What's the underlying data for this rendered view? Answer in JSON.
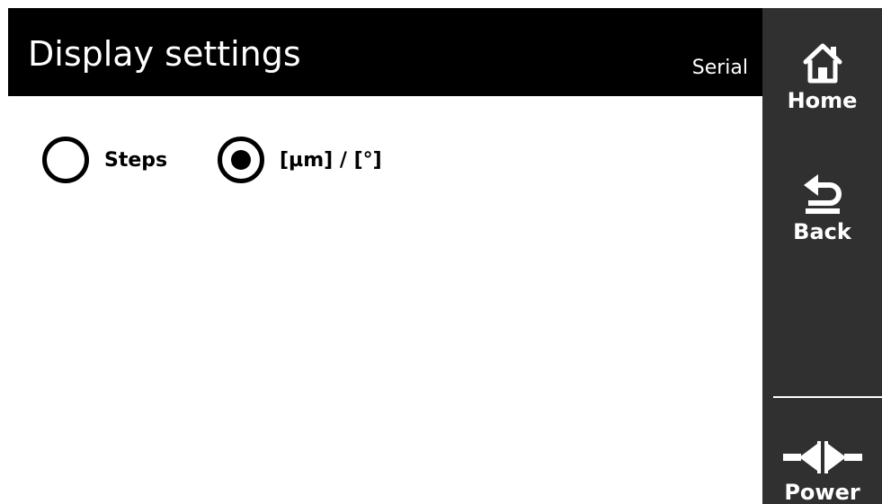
{
  "header": {
    "title": "Display settings",
    "mode": "Serial"
  },
  "display_options": {
    "selected": "units",
    "items": [
      {
        "id": "steps",
        "label": "Steps",
        "selected": false
      },
      {
        "id": "units",
        "label": "[µm] / [°]",
        "selected": true
      }
    ]
  },
  "sidebar": {
    "home_label": "Home",
    "home_icon": "home-icon",
    "back_label": "Back",
    "back_icon": "back-arrow-icon",
    "power_label": "Power",
    "power_icon": "power-plug-icon"
  },
  "colors": {
    "header_bg": "#000000",
    "header_text": "#ffffff",
    "sidebar_bg": "#303030",
    "sidebar_text": "#ffffff",
    "content_bg": "#ffffff"
  }
}
